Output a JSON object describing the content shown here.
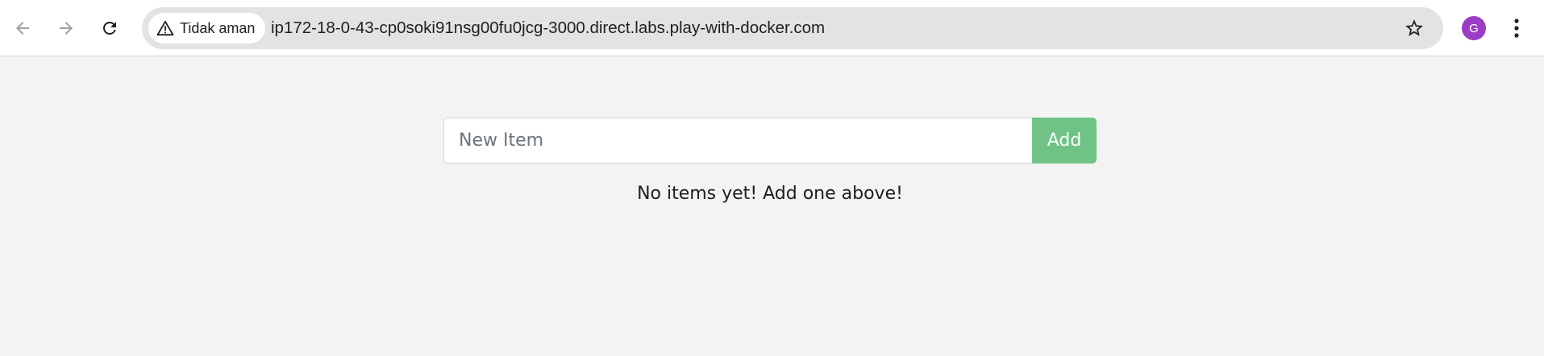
{
  "browser": {
    "security_label": "Tidak aman",
    "url": "ip172-18-0-43-cp0soki91nsg00fu0jcg-3000.direct.labs.play-with-docker.com",
    "profile_initial": "G",
    "profile_color": "#9a3dc4",
    "icons": {
      "back": "arrow-left-icon",
      "forward": "arrow-right-icon",
      "reload": "reload-icon",
      "security": "warning-triangle-icon",
      "bookmark": "star-icon",
      "menu": "kebab-menu-icon"
    }
  },
  "app": {
    "new_item_placeholder": "New Item",
    "new_item_value": "",
    "add_label": "Add",
    "add_button_color": "#6fc485",
    "empty_message": "No items yet! Add one above!"
  }
}
